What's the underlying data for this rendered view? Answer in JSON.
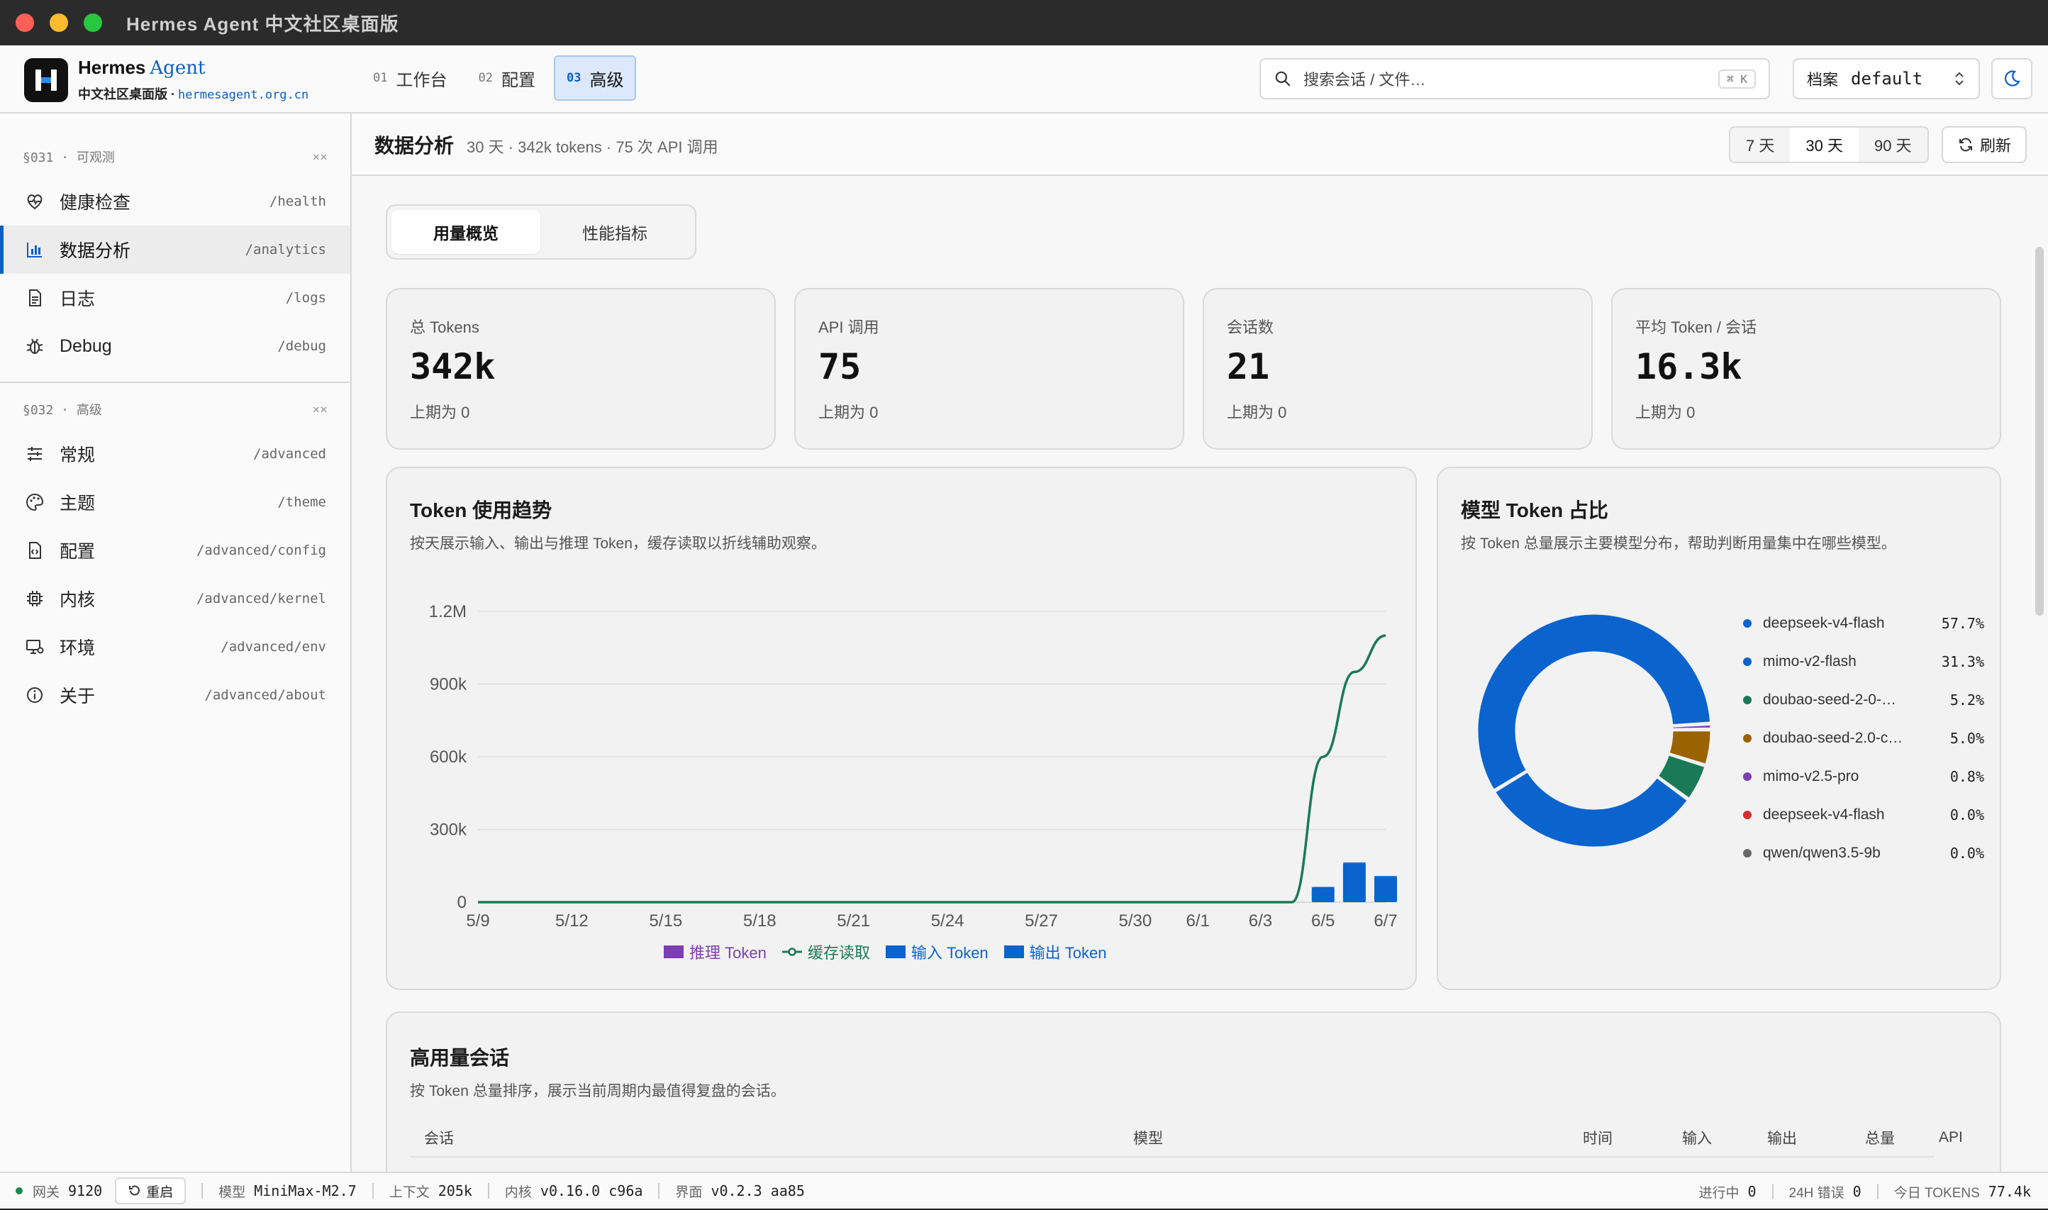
{
  "window": {
    "title": "Hermes Agent 中文社区桌面版"
  },
  "brand": {
    "name": "Hermes",
    "agent": "Agent",
    "subtitle": "中文社区桌面版",
    "separator": "·",
    "domain": "hermesagent.org.cn"
  },
  "nav": {
    "tabs": [
      {
        "num": "01",
        "label": "工作台"
      },
      {
        "num": "02",
        "label": "配置"
      },
      {
        "num": "03",
        "label": "高级"
      }
    ]
  },
  "search": {
    "placeholder": "搜索会话 / 文件…",
    "shortcut": "⌘ K"
  },
  "profile": {
    "label": "档案",
    "value": "default"
  },
  "sidebar": {
    "section1": {
      "head": "§031 · 可观测",
      "close": "××",
      "items": [
        {
          "label": "健康检查",
          "path": "/health"
        },
        {
          "label": "数据分析",
          "path": "/analytics"
        },
        {
          "label": "日志",
          "path": "/logs"
        },
        {
          "label": "Debug",
          "path": "/debug"
        }
      ]
    },
    "section2": {
      "head": "§032 · 高级",
      "close": "××",
      "items": [
        {
          "label": "常规",
          "path": "/advanced"
        },
        {
          "label": "主题",
          "path": "/theme"
        },
        {
          "label": "配置",
          "path": "/advanced/config"
        },
        {
          "label": "内核",
          "path": "/advanced/kernel"
        },
        {
          "label": "环境",
          "path": "/advanced/env"
        },
        {
          "label": "关于",
          "path": "/advanced/about"
        }
      ]
    }
  },
  "page": {
    "title": "数据分析",
    "meta": "30 天 · 342k tokens · 75 次 API 调用",
    "ranges": [
      "7 天",
      "30 天",
      "90 天"
    ],
    "refresh": "刷新",
    "segments": [
      "用量概览",
      "性能指标"
    ]
  },
  "stats": [
    {
      "label": "总 Tokens",
      "value": "342k",
      "prev": "上期为 0"
    },
    {
      "label": "API 调用",
      "value": "75",
      "prev": "上期为 0"
    },
    {
      "label": "会话数",
      "value": "21",
      "prev": "上期为 0"
    },
    {
      "label": "平均 Token / 会话",
      "value": "16.3k",
      "prev": "上期为 0"
    }
  ],
  "trend": {
    "title": "Token 使用趋势",
    "desc": "按天展示输入、输出与推理 Token，缓存读取以折线辅助观察。"
  },
  "share": {
    "title": "模型 Token 占比",
    "desc": "按 Token 总量展示主要模型分布，帮助判断用量集中在哪些模型。"
  },
  "chart_data": [
    {
      "type": "bar",
      "title": "Token 使用趋势",
      "x_ticks": [
        "5/9",
        "5/12",
        "5/15",
        "5/18",
        "5/21",
        "5/24",
        "5/27",
        "5/30",
        "6/1",
        "6/3",
        "6/5",
        "6/7"
      ],
      "y_ticks": [
        "0",
        "300k",
        "600k",
        "900k",
        "1.2M"
      ],
      "ylim": [
        0,
        1200000
      ],
      "legend_placement": "bottom",
      "series": [
        {
          "name": "推理 Token",
          "kind": "bar",
          "color": "#7b3fb3",
          "points": []
        },
        {
          "name": "缓存读取",
          "kind": "line",
          "color": "#1a7a55",
          "points": [
            [
              "5/9",
              0
            ],
            [
              "6/3",
              0
            ],
            [
              "6/4",
              0
            ],
            [
              "6/5",
              600000
            ],
            [
              "6/6",
              950000
            ],
            [
              "6/7",
              1100000
            ]
          ]
        },
        {
          "name": "输入 Token",
          "kind": "bar",
          "color": "#0b63ce",
          "points": [
            [
              "6/5",
              60000
            ],
            [
              "6/6",
              160000
            ],
            [
              "6/7",
              105000
            ]
          ]
        },
        {
          "name": "输出 Token",
          "kind": "bar",
          "color": "#0b63ce",
          "points": [
            [
              "6/5",
              3000
            ],
            [
              "6/6",
              4000
            ],
            [
              "6/7",
              3000
            ]
          ]
        }
      ]
    },
    {
      "type": "pie",
      "title": "模型 Token 占比",
      "legend_placement": "right",
      "slices": [
        {
          "name": "deepseek-v4-flash",
          "pct_label": "57.7%",
          "value": 57.7,
          "color": "#0b63ce"
        },
        {
          "name": "mimo-v2-flash",
          "pct_label": "31.3%",
          "value": 31.3,
          "color": "#0b63ce"
        },
        {
          "name": "doubao-seed-2-0-…",
          "pct_label": "5.2%",
          "value": 5.2,
          "color": "#1a7a55"
        },
        {
          "name": "doubao-seed-2.0-c…",
          "pct_label": "5.0%",
          "value": 5.0,
          "color": "#9a6200"
        },
        {
          "name": "mimo-v2.5-pro",
          "pct_label": "0.8%",
          "value": 0.8,
          "color": "#7b3fb3"
        },
        {
          "name": "deepseek-v4-flash",
          "pct_label": "0.0%",
          "value": 0.0,
          "color": "#d32f2f"
        },
        {
          "name": "qwen/qwen3.5-9b",
          "pct_label": "0.0%",
          "value": 0.0,
          "color": "#666666"
        }
      ]
    }
  ],
  "sessions": {
    "title": "高用量会话",
    "desc": "按 Token 总量排序，展示当前周期内最值得复盘的会话。",
    "columns": [
      "会话",
      "模型",
      "时间",
      "输入",
      "输出",
      "总量",
      "API"
    ]
  },
  "statusbar": {
    "gateway_label": "网关",
    "gateway": "9120",
    "restart": "重启",
    "model_label": "模型",
    "model": "MiniMax-M2.7",
    "context_label": "上下文",
    "context": "205k",
    "kernel_label": "内核",
    "kernel": "v0.16.0 c96a",
    "ui_label": "界面",
    "ui": "v0.2.3 aa85",
    "running_label": "进行中",
    "running": "0",
    "errors_label": "24H 错误",
    "errors": "0",
    "today_label": "今日 TOKENS",
    "today": "77.4k"
  },
  "colors": {
    "accent": "#0b5fc6",
    "gateway_ok": "#1a8a4a"
  }
}
